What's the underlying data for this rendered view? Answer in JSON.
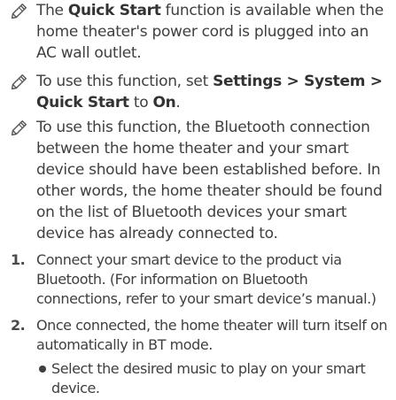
{
  "notes": [
    {
      "icon": "note-pencil-icon",
      "parts": {
        "a": "The ",
        "b": "Quick Start",
        "c": " function is available when the home theater's power cord is plugged into an AC wall outlet."
      }
    },
    {
      "icon": "note-pencil-icon",
      "parts": {
        "a": "To use this function, set ",
        "b": "Settings > System > Quick Start",
        "c": " to ",
        "d": "On",
        "e": "."
      }
    },
    {
      "icon": "note-pencil-icon",
      "parts": {
        "a": "To use this function, the Bluetooth connection between the home theater and your smart device should have been established before. In other words, the home theater should be found on the list of Bluetooth devices your smart device has already connected to."
      }
    }
  ],
  "steps": [
    {
      "number": "1.",
      "text": "Connect your smart device to the product via Bluetooth. (For information on Bluetooth connections, refer to your smart device’s manual.)"
    },
    {
      "number": "2.",
      "text": "Once connected, the home theater will turn itself on automatically in BT mode.",
      "bullets": [
        "Select the desired music to play on your smart device."
      ]
    }
  ]
}
